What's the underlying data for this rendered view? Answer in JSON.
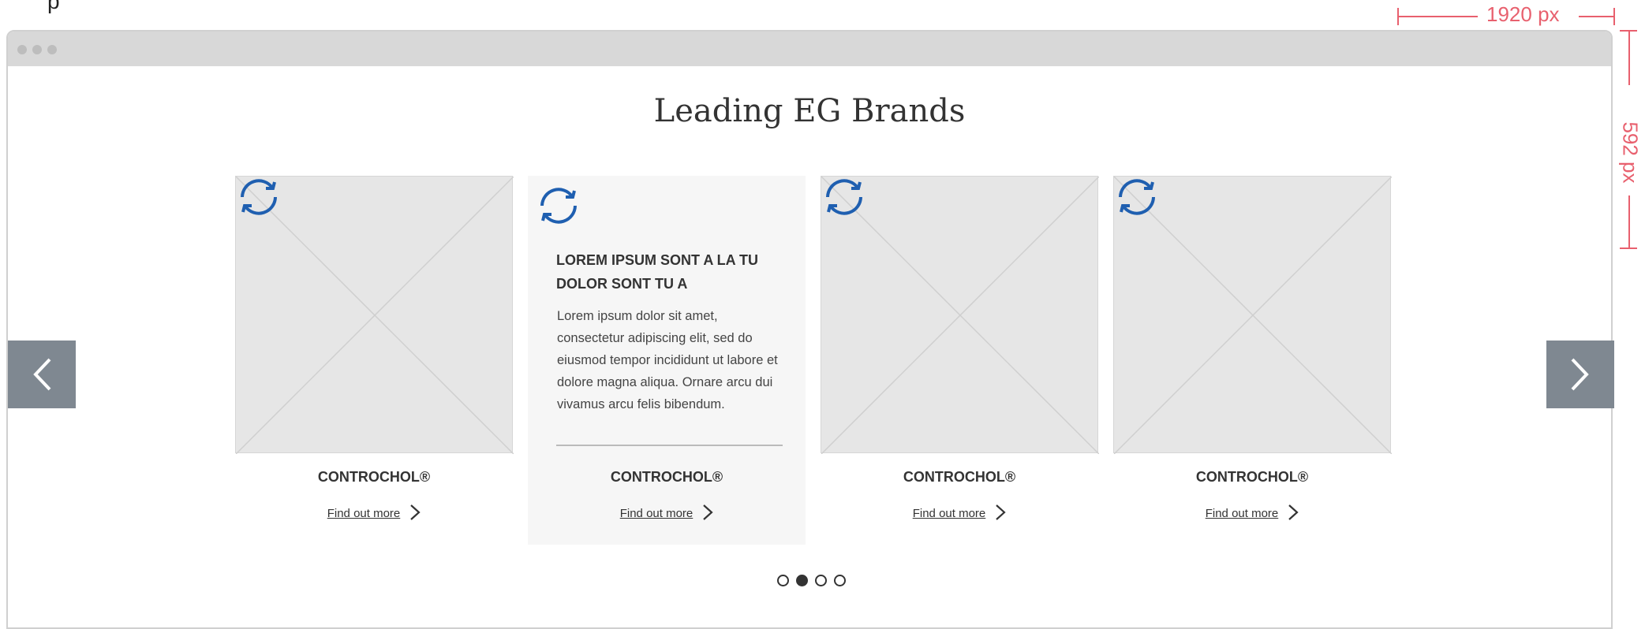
{
  "annotations": {
    "top_label": "p",
    "width_label": "1920 px",
    "height_label": "592 px"
  },
  "section": {
    "title": "Leading EG Brands"
  },
  "cards": [
    {
      "brand": "CONTROCHOL®",
      "link": "Find out more"
    },
    {
      "brand": "CONTROCHOL®",
      "link": "Find out more",
      "heading": "LOREM IPSUM SONT A LA TU DOLOR SONT TU A",
      "body": "Lorem ipsum dolor sit amet, consectetur adipiscing elit, sed do eiusmod tempor incididunt ut labore et dolore magna aliqua. Ornare arcu dui vivamus arcu felis bibendum."
    },
    {
      "brand": "CONTROCHOL®",
      "link": "Find out more"
    },
    {
      "brand": "CONTROCHOL®",
      "link": "Find out more"
    }
  ],
  "carousel": {
    "prev_icon": "chevron-left-icon",
    "next_icon": "chevron-right-icon",
    "page_count": 4,
    "active_page": 2
  },
  "colors": {
    "accent_blue": "#1f5fb0",
    "nav_button": "#7f8891",
    "dimension_red": "#e8606e",
    "placeholder": "#e6e6e6"
  }
}
